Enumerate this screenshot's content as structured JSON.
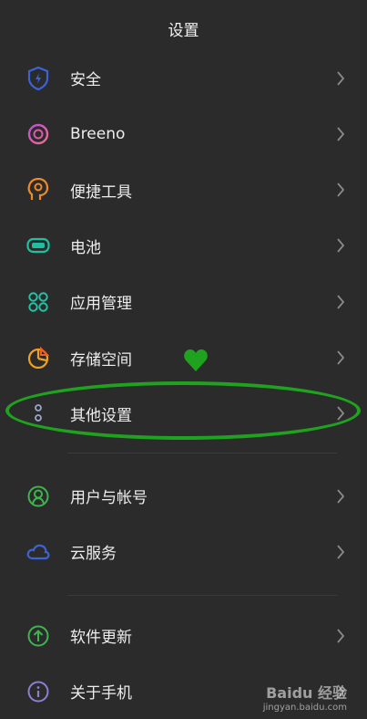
{
  "header": {
    "title": "设置"
  },
  "groups": [
    [
      {
        "name": "security",
        "label": "安全",
        "icon": "shield-bolt-icon"
      },
      {
        "name": "breeno",
        "label": "Breeno",
        "icon": "breeno-ring-icon"
      },
      {
        "name": "convenience-tools",
        "label": "便捷工具",
        "icon": "head-gear-icon"
      },
      {
        "name": "battery",
        "label": "电池",
        "icon": "battery-icon"
      },
      {
        "name": "app-management",
        "label": "应用管理",
        "icon": "app-grid-icon"
      },
      {
        "name": "storage",
        "label": "存储空间",
        "icon": "storage-pie-icon"
      },
      {
        "name": "other-settings",
        "label": "其他设置",
        "icon": "dots-icon"
      }
    ],
    [
      {
        "name": "user-account",
        "label": "用户与帐号",
        "icon": "user-circle-icon"
      },
      {
        "name": "cloud-service",
        "label": "云服务",
        "icon": "cloud-icon"
      }
    ],
    [
      {
        "name": "software-update",
        "label": "软件更新",
        "icon": "update-arrow-icon"
      },
      {
        "name": "about-phone",
        "label": "关于手机",
        "icon": "info-icon"
      }
    ]
  ],
  "watermark": {
    "brand": "Baidu 经验",
    "url": "jingyan.baidu.com"
  },
  "colors": {
    "background": "#2b2b2b",
    "highlight": "#1fa31f",
    "chevron": "#8a8a8a"
  }
}
